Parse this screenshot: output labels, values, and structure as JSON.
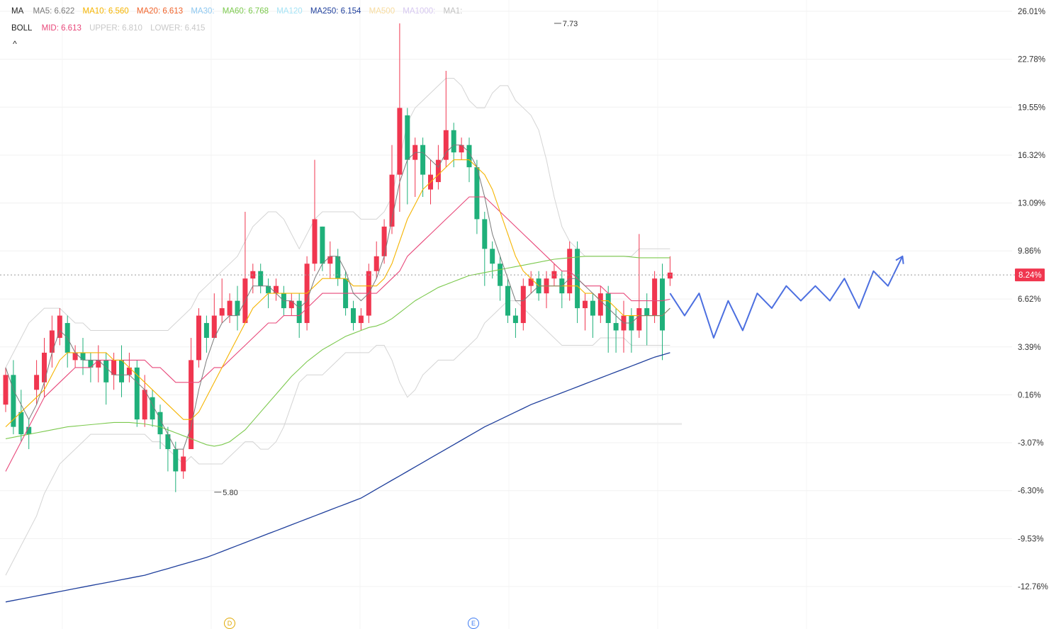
{
  "legend": {
    "ma": {
      "title": "MA",
      "items": [
        {
          "text": "MA5: 6.622",
          "color": "#7a7a7a"
        },
        {
          "text": "MA10: 6.560",
          "color": "#f5b400"
        },
        {
          "text": "MA20: 6.613",
          "color": "#f0642c"
        },
        {
          "text": "MA30:",
          "color": "#8ec8f0"
        },
        {
          "text": "MA60: 6.768",
          "color": "#7cc94e"
        },
        {
          "text": "MA120",
          "color": "#a6e3f5"
        },
        {
          "text": "MA250: 6.154",
          "color": "#1f3f9c"
        },
        {
          "text": "MA500",
          "color": "#f7dca0"
        },
        {
          "text": "MA1000:",
          "color": "#d6c8f0"
        },
        {
          "text": "MA1:",
          "color": "#c0c0c0"
        }
      ]
    },
    "boll": {
      "title": "BOLL",
      "items": [
        {
          "text": "MID: 6.613",
          "color": "#e8487a"
        },
        {
          "text": "UPPER: 6.810",
          "color": "#c8c8c8"
        },
        {
          "text": "LOWER: 6.415",
          "color": "#c8c8c8"
        }
      ]
    },
    "collapse_icon": "^"
  },
  "markers": {
    "d": "D",
    "e": "E"
  },
  "chart_data": {
    "type": "candlestick",
    "y_axis": {
      "side": "right",
      "scale": "percent",
      "ticks": [
        "26.01%",
        "22.78%",
        "19.55%",
        "16.32%",
        "13.09%",
        "9.86%",
        "6.62%",
        "3.39%",
        "0.16%",
        "-3.07%",
        "-6.30%",
        "-9.53%",
        "-12.76%"
      ],
      "tick_values": [
        26.01,
        22.78,
        19.55,
        16.32,
        13.09,
        9.86,
        6.62,
        3.39,
        0.16,
        -3.07,
        -6.3,
        -9.53,
        -12.76
      ],
      "ylim": [
        -14.0,
        27.0
      ]
    },
    "grid": true,
    "current_value_label": "8.24%",
    "current_value": 8.24,
    "annotations": [
      {
        "text": "7.73",
        "bar": 71,
        "value": 25.2,
        "type": "high"
      },
      {
        "text": "5.80",
        "bar": 27,
        "value": -6.4,
        "type": "low"
      }
    ],
    "colors": {
      "up": "#f0364f",
      "down": "#1fb07a",
      "forecast": "#4c6fe0"
    },
    "candles": [
      [
        -0.5,
        1.5,
        2.0,
        -1.0
      ],
      [
        1.5,
        -2.0,
        2.5,
        -2.5
      ],
      [
        -1.0,
        -2.5,
        0.5,
        -3.0
      ],
      [
        -2.0,
        -2.5,
        -1.5,
        -3.5
      ],
      [
        0.5,
        1.5,
        2.5,
        -0.5
      ],
      [
        1.0,
        3.0,
        4.0,
        0.0
      ],
      [
        3.0,
        4.5,
        5.5,
        2.0
      ],
      [
        4.0,
        5.5,
        6.0,
        3.5
      ],
      [
        5.0,
        3.0,
        5.5,
        2.0
      ],
      [
        2.5,
        3.0,
        3.5,
        2.0
      ],
      [
        3.0,
        2.5,
        4.0,
        1.5
      ],
      [
        2.5,
        2.0,
        3.0,
        1.0
      ],
      [
        2.0,
        2.5,
        3.5,
        1.0
      ],
      [
        2.5,
        1.0,
        3.0,
        -0.5
      ],
      [
        1.5,
        2.5,
        3.0,
        0.5
      ],
      [
        2.5,
        1.0,
        3.5,
        0.0
      ],
      [
        1.5,
        2.0,
        3.0,
        1.0
      ],
      [
        2.0,
        -1.5,
        2.5,
        -2.0
      ],
      [
        -1.5,
        0.5,
        1.5,
        -2.0
      ],
      [
        0.0,
        -1.5,
        0.5,
        -2.0
      ],
      [
        -1.0,
        -2.5,
        -0.5,
        -3.5
      ],
      [
        -2.5,
        -3.5,
        -2.0,
        -5.0
      ],
      [
        -3.5,
        -5.0,
        -3.0,
        -6.4
      ],
      [
        -5.0,
        -4.0,
        -3.5,
        -5.5
      ],
      [
        -3.5,
        2.5,
        4.0,
        -3.5
      ],
      [
        2.5,
        5.5,
        6.0,
        2.0
      ],
      [
        5.0,
        4.0,
        5.5,
        3.0
      ],
      [
        4.0,
        5.5,
        7.0,
        4.5
      ],
      [
        5.5,
        6.0,
        8.0,
        5.0
      ],
      [
        5.5,
        6.5,
        7.0,
        5.0
      ],
      [
        6.5,
        5.5,
        7.5,
        4.5
      ],
      [
        5.0,
        8.0,
        12.5,
        5.0
      ],
      [
        8.0,
        8.5,
        9.0,
        7.0
      ],
      [
        8.5,
        7.5,
        9.0,
        7.0
      ],
      [
        7.5,
        7.0,
        8.0,
        6.0
      ],
      [
        7.0,
        7.5,
        8.0,
        6.5
      ],
      [
        7.0,
        6.0,
        7.5,
        5.5
      ],
      [
        6.0,
        6.5,
        7.0,
        5.5
      ],
      [
        6.5,
        5.0,
        7.0,
        4.0
      ],
      [
        5.0,
        9.0,
        9.5,
        4.5
      ],
      [
        9.0,
        12.0,
        16.0,
        8.5
      ],
      [
        11.5,
        9.0,
        11.5,
        8.5
      ],
      [
        9.0,
        9.5,
        10.5,
        8.0
      ],
      [
        9.5,
        8.0,
        10.0,
        7.5
      ],
      [
        8.0,
        6.0,
        8.5,
        5.5
      ],
      [
        6.0,
        5.0,
        6.5,
        4.5
      ],
      [
        5.0,
        5.5,
        6.0,
        4.5
      ],
      [
        5.5,
        8.5,
        9.0,
        5.0
      ],
      [
        8.5,
        9.5,
        10.5,
        8.0
      ],
      [
        9.5,
        11.5,
        12.0,
        9.0
      ],
      [
        11.5,
        15.0,
        17.0,
        11.0
      ],
      [
        15.0,
        19.5,
        25.2,
        12.5
      ],
      [
        19.0,
        16.0,
        19.5,
        13.0
      ],
      [
        16.0,
        17.0,
        17.5,
        13.5
      ],
      [
        17.0,
        15.0,
        17.5,
        13.5
      ],
      [
        14.0,
        15.0,
        16.0,
        13.0
      ],
      [
        14.5,
        16.0,
        17.0,
        14.0
      ],
      [
        16.0,
        18.0,
        22.0,
        15.5
      ],
      [
        18.0,
        16.5,
        18.5,
        15.5
      ],
      [
        16.5,
        17.0,
        17.5,
        16.0
      ],
      [
        17.0,
        15.5,
        17.5,
        14.5
      ],
      [
        15.5,
        12.0,
        16.0,
        11.0
      ],
      [
        12.0,
        10.0,
        12.5,
        7.5
      ],
      [
        10.0,
        9.0,
        10.5,
        8.0
      ],
      [
        9.0,
        7.5,
        9.5,
        6.5
      ],
      [
        7.5,
        5.5,
        8.0,
        5.0
      ],
      [
        5.5,
        5.0,
        6.0,
        4.0
      ],
      [
        5.0,
        7.5,
        8.0,
        4.5
      ],
      [
        7.5,
        8.0,
        8.5,
        7.0
      ],
      [
        8.0,
        7.0,
        8.5,
        6.5
      ],
      [
        7.0,
        8.0,
        8.5,
        6.0
      ],
      [
        8.0,
        8.5,
        9.0,
        7.5
      ],
      [
        8.0,
        7.0,
        8.5,
        6.0
      ],
      [
        7.0,
        10.0,
        10.5,
        6.5
      ],
      [
        10.0,
        6.0,
        10.5,
        5.0
      ],
      [
        6.0,
        6.5,
        7.0,
        4.5
      ],
      [
        6.5,
        5.5,
        7.0,
        4.0
      ],
      [
        5.5,
        7.0,
        7.5,
        5.0
      ],
      [
        7.0,
        5.0,
        7.5,
        3.0
      ],
      [
        5.0,
        4.5,
        6.0,
        3.0
      ],
      [
        4.5,
        5.5,
        6.5,
        3.0
      ],
      [
        5.5,
        4.5,
        6.0,
        3.0
      ],
      [
        4.5,
        6.0,
        11.0,
        4.0
      ],
      [
        6.0,
        5.5,
        7.0,
        3.5
      ],
      [
        5.5,
        8.0,
        8.5,
        5.0
      ],
      [
        8.0,
        4.5,
        9.0,
        2.5
      ],
      [
        8.0,
        8.4,
        9.5,
        7.5
      ]
    ],
    "ma5": [
      2.0,
      0.5,
      -0.5,
      -1.5,
      -0.5,
      1.0,
      3.0,
      4.5,
      4.0,
      3.0,
      2.5,
      2.5,
      2.5,
      2.0,
      1.5,
      1.5,
      1.5,
      1.0,
      0.5,
      -0.5,
      -1.5,
      -2.5,
      -3.5,
      -3.5,
      -2.0,
      0.5,
      2.5,
      4.0,
      5.0,
      5.5,
      5.5,
      6.5,
      7.5,
      7.5,
      7.5,
      7.0,
      6.5,
      6.5,
      6.0,
      6.5,
      8.0,
      9.0,
      9.5,
      9.5,
      8.5,
      7.0,
      6.5,
      7.0,
      8.0,
      9.5,
      12.0,
      14.5,
      16.0,
      16.5,
      16.5,
      16.0,
      15.5,
      16.5,
      17.0,
      17.0,
      16.5,
      15.5,
      13.5,
      11.0,
      9.5,
      8.0,
      6.5,
      6.5,
      7.0,
      7.5,
      7.5,
      7.5,
      7.5,
      8.0,
      8.0,
      7.5,
      7.0,
      6.5,
      6.0,
      5.5,
      5.0,
      5.0,
      5.5,
      5.5,
      5.5,
      5.5,
      6.0
    ],
    "ma10": [
      -2.0,
      -1.5,
      -1.0,
      -0.5,
      0.0,
      0.5,
      1.5,
      2.5,
      3.0,
      3.0,
      3.0,
      3.0,
      3.0,
      3.0,
      2.5,
      2.5,
      2.0,
      1.5,
      1.0,
      0.5,
      0.0,
      -0.5,
      -1.0,
      -1.5,
      -1.5,
      -1.0,
      0.0,
      1.0,
      2.0,
      3.0,
      4.0,
      5.0,
      6.0,
      6.5,
      7.0,
      7.0,
      7.0,
      7.0,
      7.0,
      7.0,
      7.5,
      8.0,
      8.0,
      8.0,
      8.0,
      7.5,
      7.5,
      7.5,
      7.5,
      8.0,
      9.0,
      10.5,
      12.0,
      13.0,
      14.0,
      14.5,
      15.0,
      15.5,
      16.0,
      16.0,
      16.0,
      15.5,
      15.0,
      14.0,
      12.5,
      11.0,
      9.5,
      8.5,
      8.0,
      7.5,
      7.5,
      7.5,
      7.5,
      7.5,
      7.5,
      7.0,
      7.0,
      6.5,
      6.5,
      6.0,
      5.5,
      5.5,
      5.5,
      5.5,
      5.5,
      5.5,
      6.0
    ],
    "boll_mid": [
      -5.0,
      -4.0,
      -3.0,
      -2.0,
      -1.0,
      0.0,
      0.5,
      1.0,
      1.5,
      2.0,
      2.0,
      2.0,
      2.5,
      2.5,
      2.5,
      2.5,
      2.5,
      2.5,
      2.5,
      2.0,
      2.0,
      1.5,
      1.0,
      1.0,
      1.0,
      1.0,
      1.5,
      2.0,
      2.0,
      2.5,
      3.0,
      3.5,
      4.0,
      4.5,
      5.0,
      5.0,
      5.5,
      5.5,
      5.5,
      6.0,
      6.5,
      7.0,
      7.0,
      7.0,
      7.0,
      7.0,
      7.0,
      7.0,
      7.0,
      7.5,
      8.0,
      8.5,
      9.5,
      10.0,
      10.5,
      11.0,
      11.5,
      12.0,
      12.5,
      13.0,
      13.5,
      13.5,
      13.5,
      13.0,
      12.5,
      12.0,
      11.5,
      11.0,
      10.5,
      10.0,
      9.5,
      9.0,
      8.5,
      8.5,
      8.0,
      7.5,
      7.5,
      7.5,
      7.0,
      7.0,
      7.0,
      6.5,
      6.5,
      6.5,
      6.5,
      6.5,
      6.6
    ],
    "boll_upper": [
      2.0,
      3.0,
      4.0,
      5.0,
      5.5,
      6.0,
      6.0,
      6.0,
      5.5,
      5.0,
      5.0,
      4.5,
      4.5,
      4.5,
      4.5,
      4.5,
      4.5,
      4.5,
      4.5,
      4.5,
      4.5,
      4.5,
      5.0,
      5.5,
      6.0,
      7.0,
      7.5,
      8.0,
      8.5,
      9.0,
      9.5,
      10.5,
      11.5,
      12.0,
      12.5,
      12.5,
      12.0,
      11.0,
      10.0,
      11.0,
      12.0,
      12.5,
      12.5,
      12.5,
      12.5,
      12.5,
      12.0,
      12.0,
      12.0,
      12.5,
      13.5,
      16.0,
      18.5,
      19.5,
      20.0,
      20.5,
      21.0,
      21.5,
      21.5,
      21.0,
      20.0,
      19.5,
      19.5,
      20.5,
      21.0,
      21.0,
      20.0,
      19.5,
      19.0,
      18.0,
      16.0,
      13.5,
      11.5,
      10.5,
      10.0,
      9.5,
      9.5,
      9.5,
      9.5,
      9.5,
      9.5,
      9.5,
      10.0,
      10.0,
      10.0,
      10.0,
      10.0
    ],
    "boll_lower": [
      -12.0,
      -11.0,
      -10.0,
      -9.0,
      -8.0,
      -6.5,
      -5.5,
      -4.5,
      -4.0,
      -3.5,
      -3.0,
      -2.5,
      -2.5,
      -2.5,
      -2.5,
      -2.5,
      -2.5,
      -2.5,
      -2.5,
      -3.0,
      -3.0,
      -3.5,
      -4.0,
      -4.5,
      -4.0,
      -4.5,
      -4.5,
      -4.5,
      -4.5,
      -4.0,
      -3.5,
      -3.0,
      -3.0,
      -3.5,
      -3.5,
      -3.0,
      -2.0,
      -0.5,
      1.0,
      1.5,
      1.5,
      1.5,
      2.0,
      2.5,
      3.0,
      3.0,
      3.0,
      3.0,
      3.5,
      3.5,
      2.5,
      1.0,
      0.0,
      0.5,
      1.5,
      2.0,
      2.5,
      2.5,
      2.5,
      3.0,
      3.5,
      4.0,
      5.0,
      5.5,
      6.0,
      6.5,
      6.5,
      6.0,
      5.5,
      5.0,
      4.5,
      4.0,
      3.5,
      3.5,
      3.5,
      3.5,
      3.5,
      4.0,
      4.0,
      4.0,
      4.0,
      3.5,
      3.5,
      3.5,
      3.5,
      3.5,
      3.5
    ],
    "ma60": [
      -2.8,
      -2.7,
      -2.6,
      -2.5,
      -2.4,
      -2.3,
      -2.2,
      -2.1,
      -2.0,
      -1.95,
      -1.9,
      -1.85,
      -1.8,
      -1.75,
      -1.7,
      -1.7,
      -1.7,
      -1.75,
      -1.8,
      -1.9,
      -2.0,
      -2.2,
      -2.4,
      -2.6,
      -2.8,
      -3.0,
      -3.2,
      -3.3,
      -3.2,
      -3.0,
      -2.6,
      -2.2,
      -1.6,
      -1.0,
      -0.4,
      0.2,
      0.8,
      1.4,
      1.9,
      2.4,
      2.8,
      3.2,
      3.5,
      3.8,
      4.1,
      4.3,
      4.5,
      4.7,
      4.8,
      5.0,
      5.3,
      5.7,
      6.1,
      6.5,
      6.8,
      7.1,
      7.4,
      7.6,
      7.8,
      8.0,
      8.2,
      8.3,
      8.4,
      8.5,
      8.6,
      8.7,
      8.8,
      8.9,
      9.0,
      9.1,
      9.2,
      9.3,
      9.35,
      9.4,
      9.45,
      9.5,
      9.5,
      9.5,
      9.5,
      9.5,
      9.5,
      9.45,
      9.4,
      9.4,
      9.4,
      9.4,
      9.4
    ],
    "ma250": [
      -13.8,
      -13.7,
      -13.6,
      -13.5,
      -13.4,
      -13.3,
      -13.2,
      -13.1,
      -13.0,
      -12.9,
      -12.8,
      -12.7,
      -12.6,
      -12.5,
      -12.4,
      -12.3,
      -12.2,
      -12.1,
      -12.0,
      -11.85,
      -11.7,
      -11.55,
      -11.4,
      -11.25,
      -11.1,
      -10.95,
      -10.8,
      -10.6,
      -10.4,
      -10.2,
      -10.0,
      -9.8,
      -9.6,
      -9.4,
      -9.2,
      -9.0,
      -8.8,
      -8.6,
      -8.4,
      -8.2,
      -8.0,
      -7.8,
      -7.6,
      -7.4,
      -7.2,
      -7.0,
      -6.8,
      -6.5,
      -6.2,
      -5.9,
      -5.6,
      -5.3,
      -5.0,
      -4.7,
      -4.4,
      -4.1,
      -3.8,
      -3.5,
      -3.2,
      -2.9,
      -2.6,
      -2.3,
      -2.0,
      -1.75,
      -1.5,
      -1.25,
      -1.0,
      -0.75,
      -0.5,
      -0.3,
      -0.1,
      0.1,
      0.3,
      0.5,
      0.7,
      0.9,
      1.1,
      1.3,
      1.5,
      1.7,
      1.9,
      2.1,
      2.3,
      2.5,
      2.7,
      2.85,
      3.0
    ],
    "forecast": [
      [
        0,
        7.0
      ],
      [
        1,
        5.5
      ],
      [
        2,
        7.0
      ],
      [
        3,
        4.0
      ],
      [
        4,
        6.5
      ],
      [
        5,
        4.5
      ],
      [
        6,
        7.0
      ],
      [
        7,
        6.0
      ],
      [
        8,
        7.5
      ],
      [
        9,
        6.5
      ],
      [
        10,
        7.5
      ],
      [
        11,
        6.5
      ],
      [
        12,
        8.0
      ],
      [
        13,
        6.0
      ],
      [
        14,
        8.5
      ],
      [
        15,
        7.5
      ],
      [
        16,
        9.5
      ]
    ]
  }
}
